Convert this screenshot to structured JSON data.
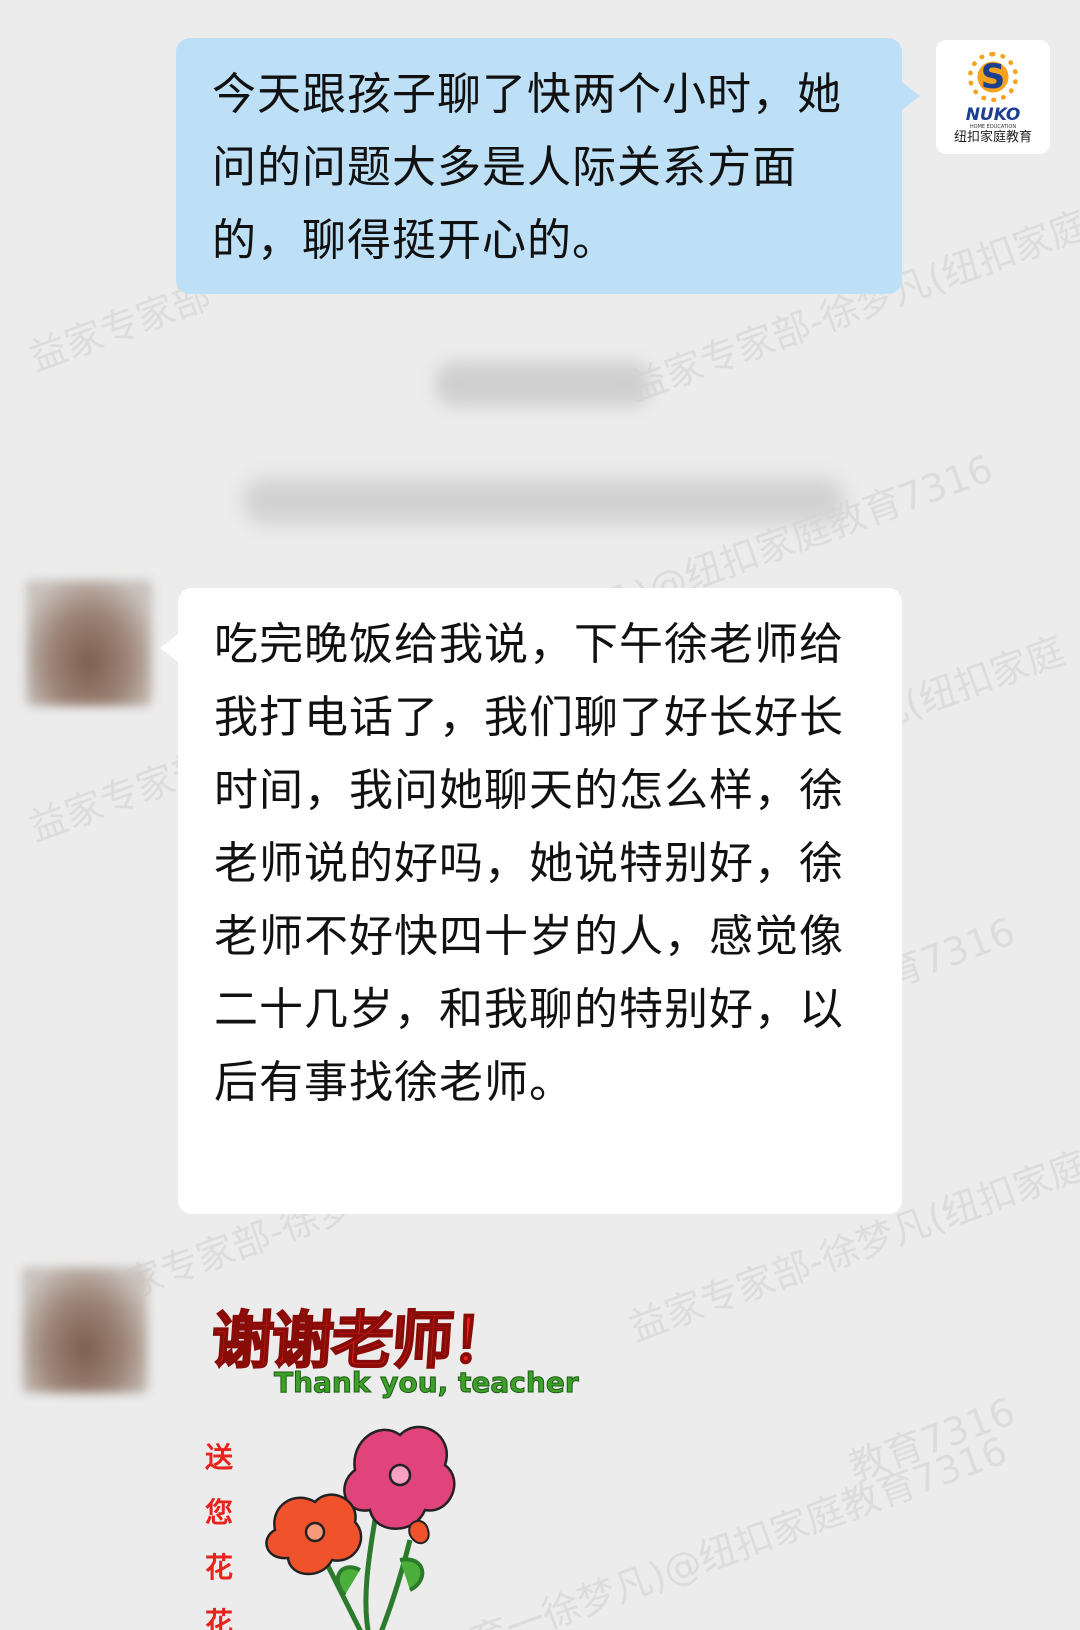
{
  "watermark": {
    "texts": [
      "益家专家部",
      "益家专家部-徐梦凡(纽扣家庭",
      "凡(纽扣家庭",
      "凡)@纽扣家庭教育7316",
      "益家专家部",
      "益家专家部-徐梦凡(纽扣家庭",
      "教育7316",
      "益家专家部-徐梦",
      "庭教育一徐梦凡)@纽扣家庭教育7316",
      "教育7316"
    ]
  },
  "messages": [
    {
      "side": "outgoing",
      "text": "今天跟孩子聊了快两个小时，她问的问题大多是人际关系方面的，聊得挺开心的。",
      "avatar": {
        "logo_mark": "S",
        "logo_name": "NUKO",
        "logo_sub": "HOME EDUCATION",
        "logo_cn": "纽扣家庭教育"
      }
    },
    {
      "side": "incoming",
      "text": "吃完晚饭给我说，下午徐老师给我打电话了，我们聊了好长好长时间，我问她聊天的怎么样，徐老师说的好吗，她说特别好，徐老师不好快四十岁的人，感觉像二十几岁，和我聊的特别好，以后有事找徐老师。"
    },
    {
      "side": "incoming",
      "sticker": {
        "title": "谢谢老师！",
        "subtitle": "Thank you, teacher",
        "side_text": [
          "送",
          "您",
          "花",
          "花"
        ]
      }
    }
  ],
  "colors": {
    "background": "#ececec",
    "outgoing_bubble": "#bde0f7",
    "incoming_bubble": "#ffffff",
    "sticker_red": "#e8231d",
    "sticker_green": "#3ea02b"
  }
}
